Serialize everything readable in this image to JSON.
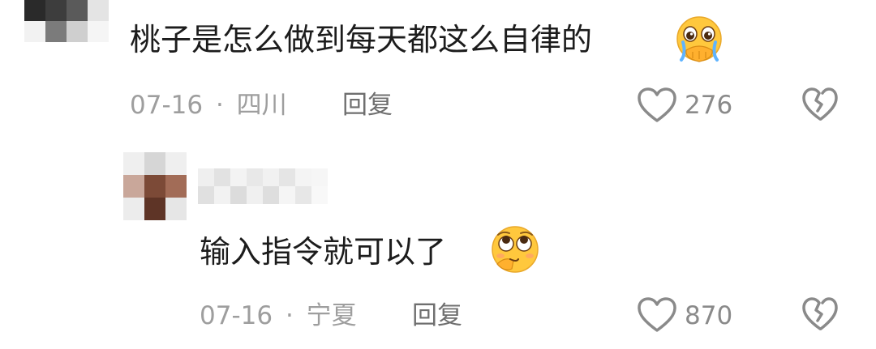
{
  "comments": [
    {
      "text": "桃子是怎么做到每天都这么自律的",
      "emoji": "crying-pleading-face",
      "date": "07-16",
      "separator": "·",
      "location": "四川",
      "reply_label": "回复",
      "likes": "276",
      "avatar_colors": [
        "#2b2b2b",
        "#4a4a4a",
        "#d9d9d9",
        "#e6e6e6",
        "#8a8a8a",
        "#5c5c5c",
        "#c9c9c9",
        "#f0f0f0"
      ]
    },
    {
      "text": "输入指令就可以了",
      "emoji": "rolling-eyes-face",
      "date": "07-16",
      "separator": "·",
      "location": "宁夏",
      "reply_label": "回复",
      "likes": "870",
      "avatar_colors": [
        "#e8e8e8",
        "#8c5a46",
        "#d0d0d0",
        "#7b4b38",
        "#5a3326",
        "#a06a54",
        "#e4e4e4",
        "#c8a292",
        "#eeeeee"
      ]
    }
  ],
  "colors": {
    "text": "#1c1c1c",
    "meta": "#9e9e9e",
    "reply": "#6f6f6f",
    "icon": "#8a8a8a",
    "emoji_face": "#ffc83d"
  },
  "icons": {
    "like": "heart-outline-icon",
    "dislike": "broken-heart-icon"
  }
}
